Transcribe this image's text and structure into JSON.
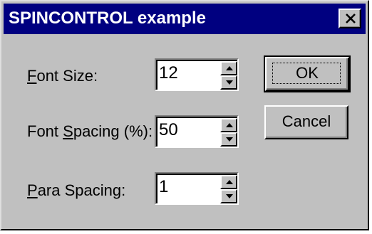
{
  "window": {
    "title": "SPINCONTROL example",
    "close_icon": "close-icon"
  },
  "fields": [
    {
      "mnemonic": "F",
      "label_rest": "ont Size:",
      "value": "12"
    },
    {
      "label_pre": "Font ",
      "mnemonic": "S",
      "label_rest": "pacing (%):",
      "value": "50"
    },
    {
      "mnemonic": "P",
      "label_rest": "ara Spacing:",
      "value": "1"
    }
  ],
  "buttons": {
    "ok_label": "OK",
    "cancel_label": "Cancel"
  },
  "icons": {
    "spin_up": "arrow-up-icon",
    "spin_down": "arrow-down-icon"
  },
  "colors": {
    "titlebar": "#000080",
    "face": "#c0c0c0"
  }
}
